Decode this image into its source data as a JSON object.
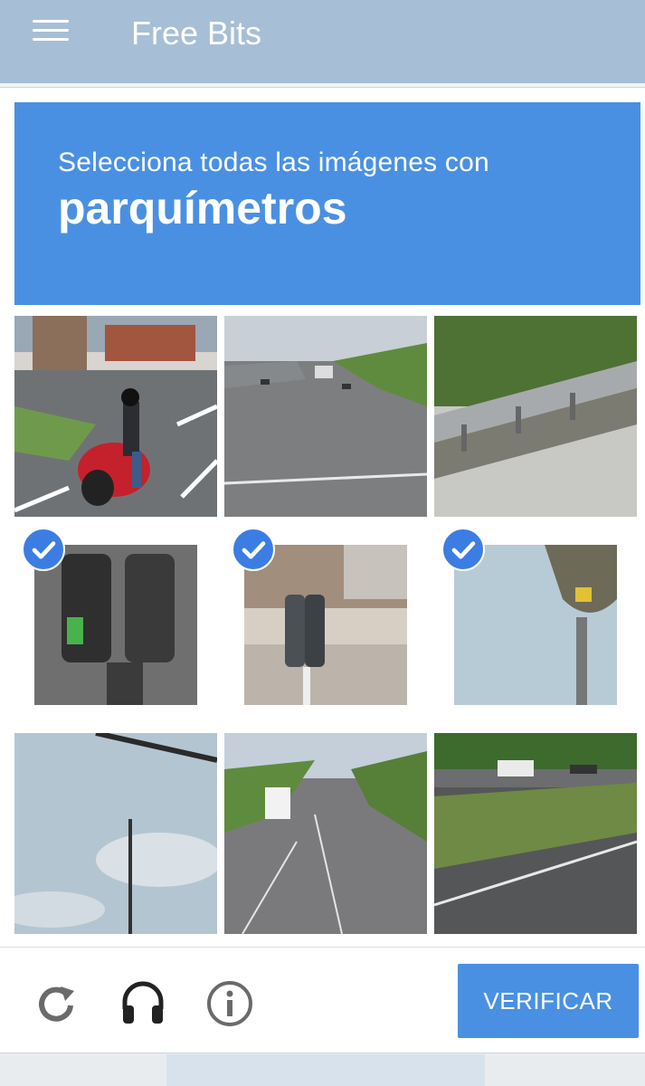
{
  "appbar": {
    "title": "Free Bits",
    "menu_icon": "hamburger-menu-icon"
  },
  "challenge": {
    "instruction": "Selecciona todas las imágenes con",
    "target": "parquímetros",
    "header_color": "#4a90e2",
    "tiles": [
      {
        "content": "motorcycle-street",
        "selected": false
      },
      {
        "content": "road",
        "selected": false
      },
      {
        "content": "guardrail",
        "selected": false
      },
      {
        "content": "parking-meter-closeup",
        "selected": true
      },
      {
        "content": "parking-meter-sidewalk",
        "selected": true
      },
      {
        "content": "parking-meter-sky",
        "selected": true
      },
      {
        "content": "sky-pole",
        "selected": false
      },
      {
        "content": "road-truck",
        "selected": false
      },
      {
        "content": "highway-truck",
        "selected": false
      }
    ]
  },
  "controls": {
    "reload_icon": "reload-icon",
    "audio_icon": "headphones-icon",
    "info_icon": "info-icon",
    "verify_label": "VERIFICAR"
  }
}
